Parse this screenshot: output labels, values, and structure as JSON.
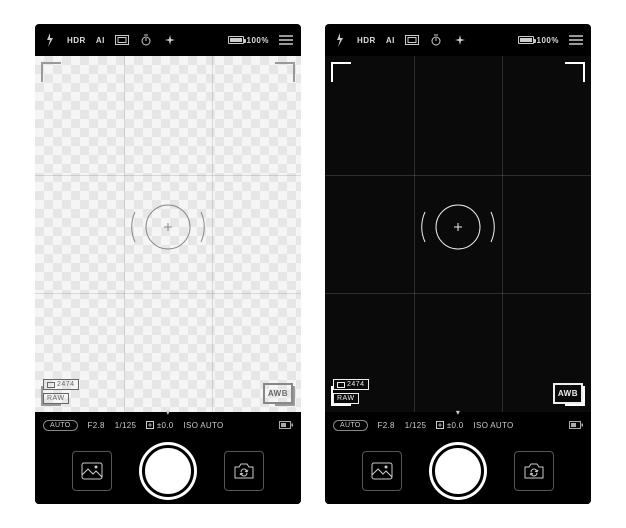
{
  "topbar": {
    "hdr_label": "HDR",
    "ai_label": "AI",
    "battery_pct": "100%"
  },
  "viewfinder": {
    "photo_count": "2474",
    "raw_label": "RAW",
    "awb_label": "AWB"
  },
  "settings": {
    "mode_label": "AUTO",
    "aperture": "F2.8",
    "shutter": "1/125",
    "ev": "±0.0",
    "iso": "ISO AUTO"
  }
}
